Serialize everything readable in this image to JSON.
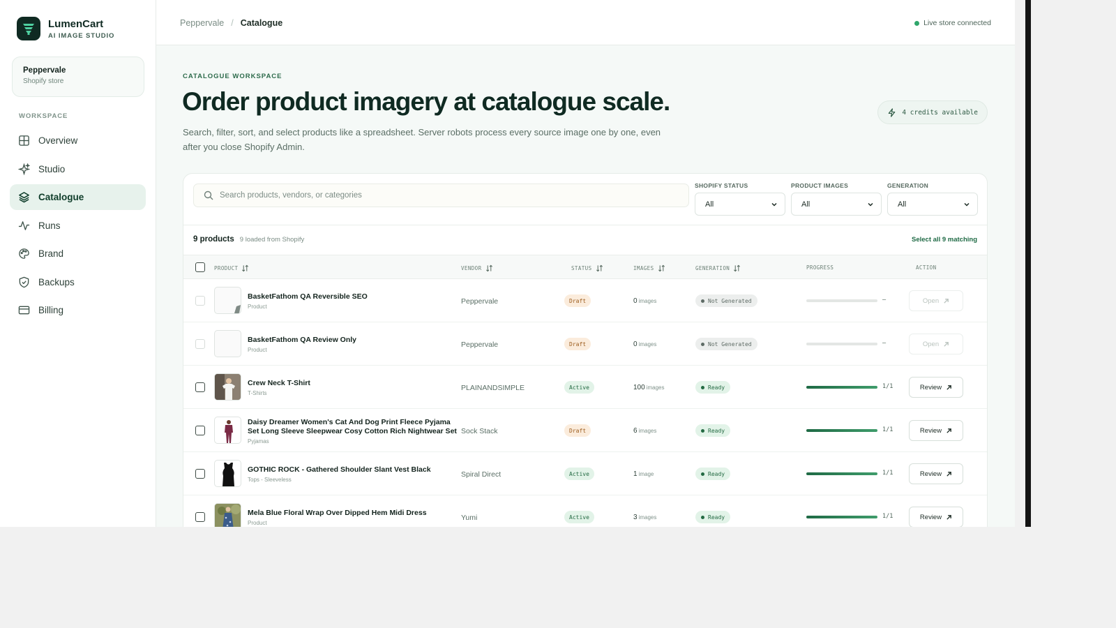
{
  "app": {
    "name": "LumenCart",
    "subtitle": "AI IMAGE STUDIO"
  },
  "store": {
    "name": "Peppervale",
    "type": "Shopify store"
  },
  "sidebar": {
    "section_label": "WORKSPACE",
    "items": [
      {
        "label": "Overview",
        "icon": "grid-icon",
        "active": false
      },
      {
        "label": "Studio",
        "icon": "sparkle-icon",
        "active": false
      },
      {
        "label": "Catalogue",
        "icon": "layers-icon",
        "active": true
      },
      {
        "label": "Runs",
        "icon": "activity-icon",
        "active": false
      },
      {
        "label": "Brand",
        "icon": "palette-icon",
        "active": false
      },
      {
        "label": "Backups",
        "icon": "shield-icon",
        "active": false
      },
      {
        "label": "Billing",
        "icon": "credit-card-icon",
        "active": false
      }
    ]
  },
  "breadcrumb": {
    "parent": "Peppervale",
    "separator": "/",
    "current": "Catalogue"
  },
  "connection": {
    "label": "Live store connected",
    "color": "#2fa66b"
  },
  "page": {
    "eyebrow": "CATALOGUE WORKSPACE",
    "title": "Order product imagery at catalogue scale.",
    "description": "Search, filter, sort, and select products like a spreadsheet. Server robots process every source image one by one, even after you close Shopify Admin.",
    "credits": "4 credits available"
  },
  "search": {
    "placeholder": "Search products, vendors, or categories"
  },
  "filters": [
    {
      "label": "SHOPIFY STATUS",
      "value": "All"
    },
    {
      "label": "PRODUCT IMAGES",
      "value": "All"
    },
    {
      "label": "GENERATION",
      "value": "All"
    }
  ],
  "summary": {
    "count": "9 products",
    "loaded": "9 loaded from Shopify",
    "select_all": "Select all 9 matching"
  },
  "table": {
    "columns": {
      "product": "PRODUCT",
      "vendor": "VENDOR",
      "status": "STATUS",
      "images": "IMAGES",
      "generation": "GENERATION",
      "progress": "PROGRESS",
      "action": "ACTION"
    },
    "rows": [
      {
        "name": "BasketFathom QA Reversible SEO",
        "category": "Product",
        "vendor": "Peppervale",
        "status": "Draft",
        "images_count": "0",
        "images_unit": "images",
        "generation": "Not Generated",
        "progress": 0,
        "progress_label": "–",
        "action": "Open",
        "enabled": false,
        "thumb": "blank-corner"
      },
      {
        "name": "BasketFathom QA Review Only",
        "category": "Product",
        "vendor": "Peppervale",
        "status": "Draft",
        "images_count": "0",
        "images_unit": "images",
        "generation": "Not Generated",
        "progress": 0,
        "progress_label": "–",
        "action": "Open",
        "enabled": false,
        "thumb": "blank"
      },
      {
        "name": "Crew Neck T-Shirt",
        "category": "T-Shirts",
        "vendor": "PLAINANDSIMPLE",
        "status": "Active",
        "images_count": "100",
        "images_unit": "images",
        "generation": "Ready",
        "progress": 1,
        "progress_label": "1/1",
        "action": "Review",
        "enabled": true,
        "thumb": "tshirt"
      },
      {
        "name": "Daisy Dreamer Women's Cat And Dog Print Fleece Pyjama Set Long Sleeve Sleepwear Cosy Cotton Rich Nightwear Set",
        "category": "Pyjamas",
        "vendor": "Sock Stack",
        "status": "Draft",
        "images_count": "6",
        "images_unit": "images",
        "generation": "Ready",
        "progress": 1,
        "progress_label": "1/1",
        "action": "Review",
        "enabled": true,
        "thumb": "pyjama"
      },
      {
        "name": "GOTHIC ROCK - Gathered Shoulder Slant Vest Black",
        "category": "Tops - Sleeveless",
        "vendor": "Spiral Direct",
        "status": "Active",
        "images_count": "1",
        "images_unit": "image",
        "generation": "Ready",
        "progress": 1,
        "progress_label": "1/1",
        "action": "Review",
        "enabled": true,
        "thumb": "vest"
      },
      {
        "name": "Mela Blue Floral Wrap Over Dipped Hem Midi Dress",
        "category": "Product",
        "vendor": "Yumi",
        "status": "Active",
        "images_count": "3",
        "images_unit": "images",
        "generation": "Ready",
        "progress": 1,
        "progress_label": "1/1",
        "action": "Review",
        "enabled": true,
        "thumb": "dress"
      }
    ]
  },
  "colors": {
    "brand": "#0f2a22",
    "accent": "#1f6a45",
    "draft": "#9b5b1c",
    "ready": "#236a42"
  }
}
